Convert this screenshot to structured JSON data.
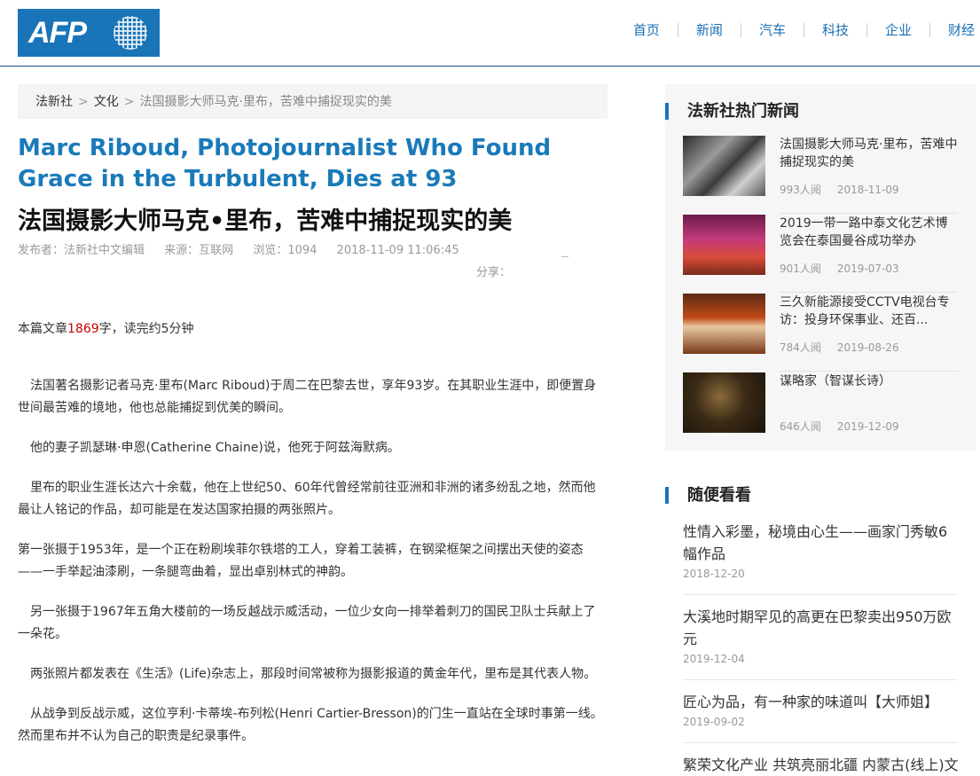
{
  "header": {
    "logo_text": "AFP",
    "nav": [
      "首页",
      "新闻",
      "汽车",
      "科技",
      "企业",
      "财经"
    ]
  },
  "breadcrumb": {
    "home": "法新社",
    "section": "文化",
    "separator": ">",
    "current": "法国摄影大师马克·里布，苦难中捕捉现实的美"
  },
  "article": {
    "title_en": "Marc Riboud, Photojournalist Who Found Grace in the Turbulent, Dies at 93",
    "title_zh": "法国摄影大师马克•里布，苦难中捕捉现实的美",
    "meta": {
      "publisher": "发布者：法新社中文编辑",
      "source": "来源：互联网",
      "views": "浏览：1094",
      "date": "2018-11-09 11:06:45"
    },
    "share_label": "分享：",
    "read_prefix": "本篇文章",
    "char_count": "1869",
    "read_suffix": "字，读完约5分钟",
    "paragraphs": [
      "　法国著名摄影记者马克·里布(Marc Riboud)于周二在巴黎去世，享年93岁。在其职业生涯中，即便置身世间最苦难的境地，他也总能捕捉到优美的瞬间。",
      "　他的妻子凯瑟琳·申恩(Catherine Chaine)说，他死于阿兹海默病。",
      "　里布的职业生涯长达六十余载，他在上世纪50、60年代曾经常前往亚洲和非洲的诸多纷乱之地，然而他最让人铭记的作品，却可能是在发达国家拍摄的两张照片。",
      "第一张摄于1953年，是一个正在粉刷埃菲尔铁塔的工人，穿着工装裤，在钢梁框架之间摆出天使的姿态——一手举起油漆刷，一条腿弯曲着，显出卓别林式的神韵。",
      "　另一张摄于1967年五角大楼前的一场反越战示威活动，一位少女向一排举着刺刀的国民卫队士兵献上了一朵花。",
      "　两张照片都发表在《生活》(Life)杂志上，那段时间常被称为摄影报道的黄金年代，里布是其代表人物。",
      "　从战争到反战示威，这位亨利·卡蒂埃-布列松(Henri Cartier-Bresson)的门生一直站在全球时事第一线。然而里布并不认为自己的职责是纪录事件。"
    ]
  },
  "sidebar": {
    "hot_title": "法新社热门新闻",
    "hot_news": [
      {
        "title": "法国摄影大师马克·里布，苦难中捕捉现实的美",
        "views": "993人阅",
        "date": "2018-11-09",
        "thumb": "bw-photographer-photo"
      },
      {
        "title": "2019一带一路中泰文化艺术博览会在泰国曼谷成功举办",
        "views": "901人阅",
        "date": "2019-07-03",
        "thumb": "stage-performance-photo"
      },
      {
        "title": "三久新能源接受CCTV电视台专访：投身环保事业、还百...",
        "views": "784人阅",
        "date": "2019-08-26",
        "thumb": "conference-hall-photo"
      },
      {
        "title": "谋略家（智谋长诗）",
        "views": "646人阅",
        "date": "2019-12-09",
        "thumb": "dim-portrait-photo"
      }
    ],
    "random_title": "随便看看",
    "random_items": [
      {
        "title": "性情入彩墨，秘境由心生——画家门秀敏6幅作品",
        "date": "2018-12-20"
      },
      {
        "title": "大溪地时期罕见的高更在巴黎卖出950万欧元",
        "date": "2019-12-04"
      },
      {
        "title": "匠心为品，有一种家的味道叫【大师姐】",
        "date": "2019-09-02"
      },
      {
        "title": "繁荣文化产业 共筑亮丽北疆 内蒙古(线上)文",
        "date": ""
      }
    ]
  },
  "colors": {
    "brand_blue": "#1a74b8",
    "link_blue": "#1a7ab9",
    "highlight_red": "#cc0000"
  }
}
